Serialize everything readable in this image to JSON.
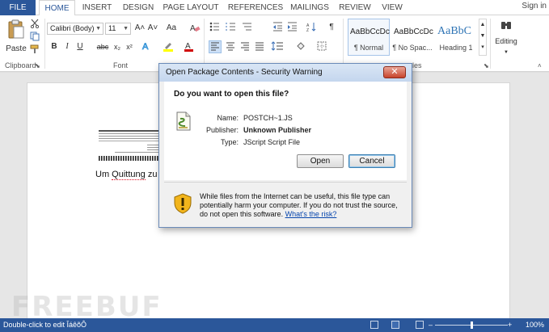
{
  "tabs": {
    "file": "FILE",
    "home": "HOME",
    "insert": "INSERT",
    "design": "DESIGN",
    "page_layout": "PAGE LAYOUT",
    "references": "REFERENCES",
    "mailings": "MAILINGS",
    "review": "REVIEW",
    "view": "VIEW"
  },
  "signin": "Sign in",
  "ribbon": {
    "clipboard": {
      "paste_label": "Paste",
      "group_label": "Clipboard"
    },
    "font": {
      "font_name": "Calibri (Body)",
      "font_size": "11",
      "group_label": "Font",
      "bold": "B",
      "italic": "I",
      "underline": "U",
      "strike": "abc",
      "subscript": "x₂",
      "superscript": "x²",
      "grow": "A˄",
      "shrink": "A˅",
      "case": "Aa"
    },
    "paragraph": {
      "pilcrow": "¶"
    },
    "styles": {
      "items": [
        {
          "preview": "AaBbCcDc",
          "name": "¶ Normal"
        },
        {
          "preview": "AaBbCcDc",
          "name": "¶ No Spac..."
        },
        {
          "preview": "AaBbC",
          "name": "Heading 1"
        }
      ],
      "group_label_partial": "les"
    },
    "editing": {
      "label": "Editing"
    }
  },
  "document": {
    "text_start": "Um ",
    "text_squiggle": "Quittung",
    "text_end": " zu s"
  },
  "watermark": "FREEBUF",
  "status": {
    "left_text": "Double-click to edit ÎáêõÔ",
    "zoom": "100%"
  },
  "dialog": {
    "title": "Open Package Contents - Security Warning",
    "close": "✕",
    "question": "Do you want to open this file?",
    "name_label": "Name:",
    "name_value": "POSTCH~1.JS",
    "publisher_label": "Publisher:",
    "publisher_value": "Unknown Publisher",
    "type_label": "Type:",
    "type_value": "JScript Script File",
    "open_button": "Open",
    "cancel_button": "Cancel",
    "warning_text": "While files from the Internet can be useful, this file type can potentially harm your computer. If you do not trust the source, do not open this software.",
    "risk_link": "What's the risk?"
  },
  "colors": {
    "accent": "#2b579a",
    "highlight": "#ffff00",
    "font_color": "#d00000",
    "close_button": "#c7432c"
  }
}
